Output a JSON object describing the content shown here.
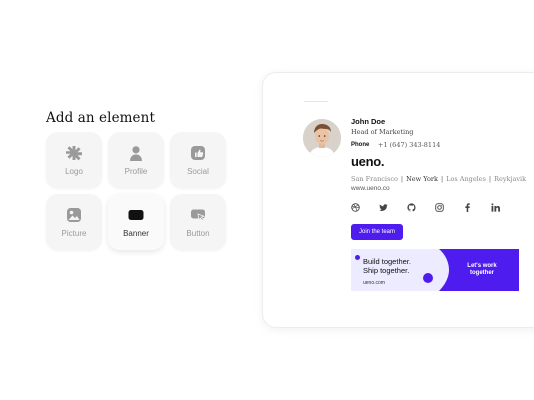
{
  "panel": {
    "title": "Add an element",
    "tiles": [
      {
        "label": "Logo",
        "icon": "logo-icon"
      },
      {
        "label": "Profile",
        "icon": "profile-icon"
      },
      {
        "label": "Social",
        "icon": "social-icon"
      },
      {
        "label": "Picture",
        "icon": "picture-icon"
      },
      {
        "label": "Banner",
        "icon": "banner-icon"
      },
      {
        "label": "Button",
        "icon": "button-icon"
      }
    ]
  },
  "signature": {
    "name": "John Doe",
    "role": "Head of Marketing",
    "phone_label": "Phone",
    "phone_value": "+1 (647) 343-8114",
    "brand": "ueno.",
    "cities": [
      "San Francisco",
      "New York",
      "Los Angeles",
      "Reykjavik"
    ],
    "website": "www.ueno.co",
    "socials": [
      "dribbble-icon",
      "twitter-icon",
      "github-icon",
      "instagram-icon",
      "facebook-icon",
      "linkedin-icon"
    ],
    "cta_label": "Join the team",
    "banner": {
      "line1": "Build together.",
      "line2": "Ship together.",
      "url": "ueno.com",
      "right_line1": "Let's work",
      "right_line2": "together"
    }
  },
  "colors": {
    "accent": "#4f1cf0",
    "banner_bg": "#ecebff",
    "tile_bg": "#f5f5f5"
  }
}
